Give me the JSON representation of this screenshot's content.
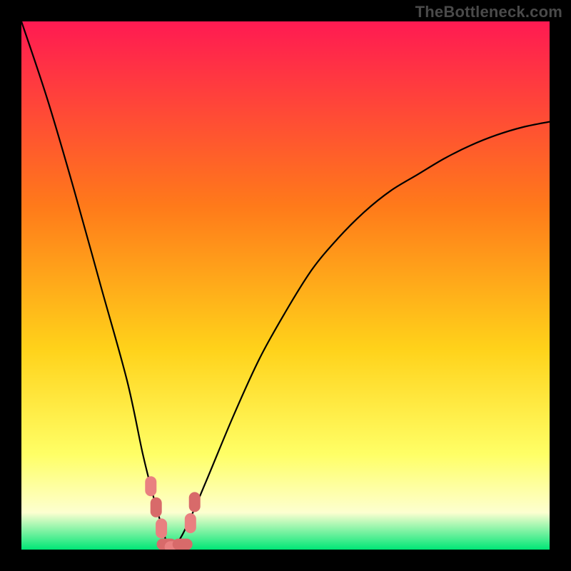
{
  "watermark": "TheBottleneck.com",
  "colors": {
    "gradient_top": "#ff1a52",
    "gradient_mid1": "#ff7a1a",
    "gradient_mid2": "#ffd21a",
    "gradient_mid3": "#ffff66",
    "gradient_pale": "#fdffd0",
    "gradient_bottom": "#00e676",
    "curve": "#000000",
    "marker_fill": "#e98080",
    "marker_alt": "#d86a6a",
    "frame": "#000000"
  },
  "chart_data": {
    "type": "line",
    "title": "",
    "xlabel": "",
    "ylabel": "",
    "xlim": [
      0,
      100
    ],
    "ylim": [
      0,
      100
    ],
    "grid": false,
    "legend": false,
    "comment": "Bottleneck-style V curve. x is relative component scale (0–100), y is bottleneck % (0 best, 100 worst). Optimum near x≈28 where y≈0.",
    "series": [
      {
        "name": "bottleneck-curve",
        "x": [
          0,
          5,
          10,
          15,
          20,
          23,
          25,
          27,
          28,
          30,
          32,
          35,
          40,
          45,
          50,
          55,
          60,
          65,
          70,
          75,
          80,
          85,
          90,
          95,
          100
        ],
        "y": [
          100,
          85,
          68,
          50,
          32,
          18,
          10,
          3,
          0,
          2,
          6,
          13,
          25,
          36,
          45,
          53,
          59,
          64,
          68,
          71,
          74,
          76.5,
          78.5,
          80,
          81
        ]
      }
    ],
    "markers": {
      "name": "optimal-range",
      "points": [
        {
          "x": 24.5,
          "y": 12
        },
        {
          "x": 25.5,
          "y": 8
        },
        {
          "x": 26.5,
          "y": 4
        },
        {
          "x": 27.5,
          "y": 1
        },
        {
          "x": 29.0,
          "y": 0.5
        },
        {
          "x": 30.5,
          "y": 1
        },
        {
          "x": 32.0,
          "y": 5
        },
        {
          "x": 32.8,
          "y": 9
        }
      ]
    }
  }
}
